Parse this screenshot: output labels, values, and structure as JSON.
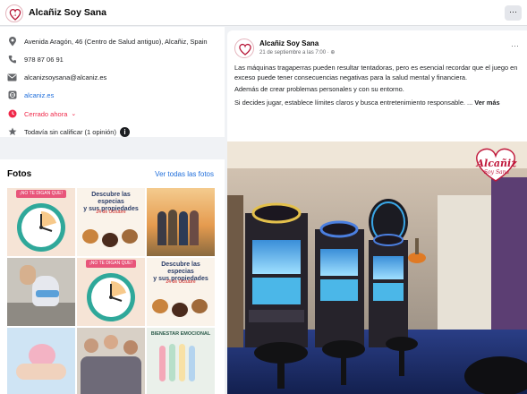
{
  "page": {
    "name": "Alcañiz Soy Sana",
    "more_label": "···"
  },
  "info": {
    "address": "Avenida Aragón, 46 (Centro de Salud antiguo), Alcañiz, Spain",
    "phone": "978 87 06 91",
    "email": "alcanizsoysana@alcaniz.es",
    "website": "alcaniz.es",
    "hours_status": "Cerrado ahora",
    "rating": "Todavía sin calificar (1 opinión)"
  },
  "photos": {
    "header": "Fotos",
    "see_all": "Ver todas las fotos",
    "items": [
      {
        "label": "clock-infographic",
        "texts": [
          "¡NO TE DIGAN QUE!",
          ""
        ]
      },
      {
        "label": "spices-event",
        "texts": [
          "Descubre las especias",
          "y sus propiedades",
          "24 de Octubre"
        ]
      },
      {
        "label": "friends-hugging",
        "texts": []
      },
      {
        "label": "running-shoes",
        "texts": []
      },
      {
        "label": "clock-infographic-2",
        "texts": [
          "¡NO TE DIGAN QUE!",
          ""
        ]
      },
      {
        "label": "spices-event-2",
        "texts": [
          "Descubre las especias",
          "y sus propiedades",
          "24 de Octubre"
        ]
      },
      {
        "label": "brain-hands",
        "texts": []
      },
      {
        "label": "family-group",
        "texts": []
      },
      {
        "label": "bienestar-emocional",
        "texts": [
          "BIENESTAR EMOCIONAL"
        ]
      }
    ]
  },
  "post": {
    "author": "Alcañiz Soy Sana",
    "date": "21 de septiembre a las 7:00 · ⊕",
    "more": "···",
    "p1": "Las máquinas tragaperras pueden resultar tentadoras, pero es esencial recordar que el juego en exceso puede tener consecuencias negativas para la salud mental y financiera.",
    "p2": "Además de crear problemas personales y con su entorno.",
    "p3": "Si decides jugar, establece límites claros y busca entretenimiento responsable. ...",
    "see_more": "Ver más",
    "watermark_line1": "Alcañiz",
    "watermark_line2": "Soy Sana"
  },
  "colors": {
    "link": "#216fdb",
    "closed": "#f02849",
    "brand": "#b8193a"
  }
}
